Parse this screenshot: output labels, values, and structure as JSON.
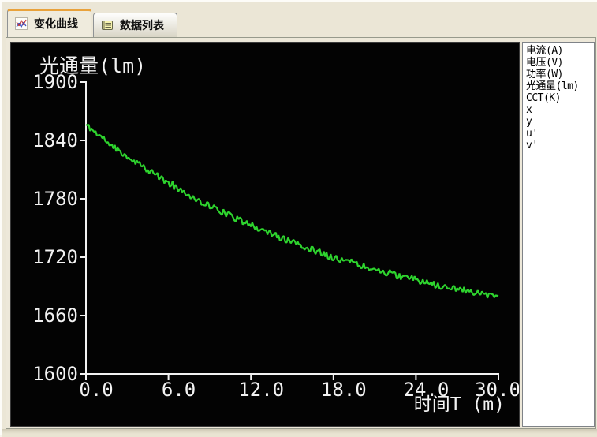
{
  "tabs": [
    {
      "label": "变化曲线",
      "icon": "curve-chart-icon",
      "active": true
    },
    {
      "label": "数据列表",
      "icon": "data-list-icon",
      "active": false
    }
  ],
  "legend": {
    "items": [
      "电流(A)",
      "电压(V)",
      "功率(W)",
      "光通量(lm)",
      "CCT(K)",
      "x",
      "y",
      "u'",
      "v'"
    ]
  },
  "chart_data": {
    "type": "line",
    "title": "光通量(lm)",
    "xlabel": "时间T (m)",
    "ylabel": "光通量(lm)",
    "x": [
      0,
      1,
      2,
      3,
      4,
      5,
      6,
      7,
      8,
      9,
      10,
      11,
      12,
      13,
      14,
      15,
      16,
      17,
      18,
      19,
      20,
      21,
      22,
      23,
      24,
      25,
      26,
      27,
      28,
      29,
      30
    ],
    "series": [
      {
        "name": "光通量(lm)",
        "values": [
          1856,
          1845,
          1834,
          1824,
          1814,
          1805,
          1796,
          1788,
          1780,
          1773,
          1766,
          1759,
          1753,
          1747,
          1741,
          1735,
          1730,
          1725,
          1720,
          1716,
          1712,
          1708,
          1704,
          1700,
          1697,
          1693,
          1690,
          1687,
          1685,
          1682,
          1679
        ]
      }
    ],
    "xlim": [
      0,
      30
    ],
    "ylim": [
      1600,
      1900
    ],
    "x_ticks": [
      0,
      6,
      12,
      18,
      24,
      30
    ],
    "x_tick_labels": [
      "0.0",
      "6.0",
      "12.0",
      "18.0",
      "24.0",
      "30.0"
    ],
    "y_ticks": [
      1900,
      1840,
      1780,
      1720,
      1660,
      1600
    ],
    "y_tick_labels": [
      "1900",
      "1840",
      "1780",
      "1720",
      "1660",
      "1600"
    ],
    "grid": false,
    "legend_position": "right-panel",
    "background": "#030303",
    "axis_color": "#f2f2f2",
    "line_color": "#2ed42e",
    "noise_amplitude": 3.5
  },
  "colors": {
    "window_bg": "#ebe6d6",
    "panel_bg": "#ede8d9",
    "active_tab_accent": "#e9a23b",
    "legend_bg": "#ffffff",
    "curve_green": "#2ed42e"
  }
}
